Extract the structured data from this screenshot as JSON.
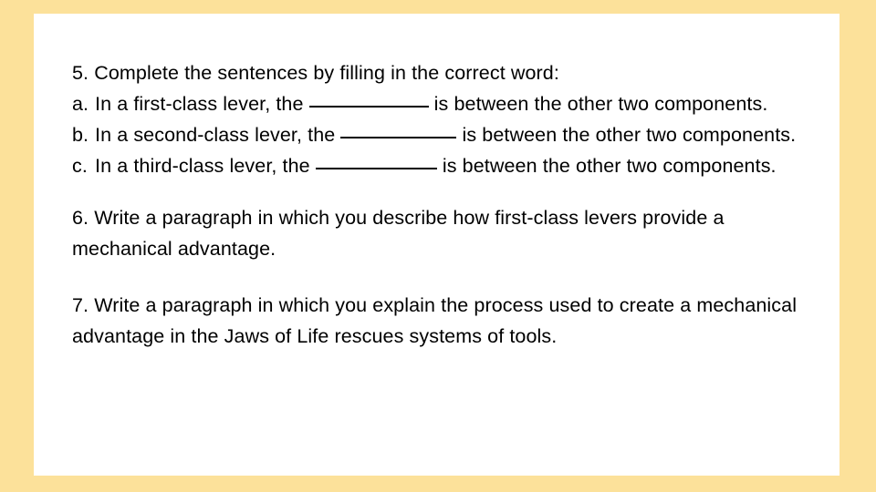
{
  "slide": {
    "background_color": "#fce19a",
    "panel_color": "#ffffff",
    "text_color": "#000000",
    "questions": {
      "q5": {
        "prompt": "5. Complete the sentences by filling in the correct word:",
        "items": [
          {
            "marker": "a.",
            "text_before_blank": "In a first-class lever, the ",
            "blank": "__________",
            "text_after_blank": " is between the other two components."
          },
          {
            "marker": "b.",
            "text_before_blank": "In a second-class lever, the ",
            "blank": "_________",
            "text_after_blank": " is between the other two components."
          },
          {
            "marker": "c.",
            "text_before_blank": "In a third-class lever, the ",
            "blank": "__________",
            "text_after_blank": " is between the other two components."
          }
        ]
      },
      "q6": {
        "text": "6. Write a paragraph in which you describe how first-class levers provide a mechanical advantage."
      },
      "q7": {
        "text": "7. Write a paragraph in which you explain the process used to create a mechanical advantage in the Jaws of Life rescues systems of tools."
      }
    }
  }
}
